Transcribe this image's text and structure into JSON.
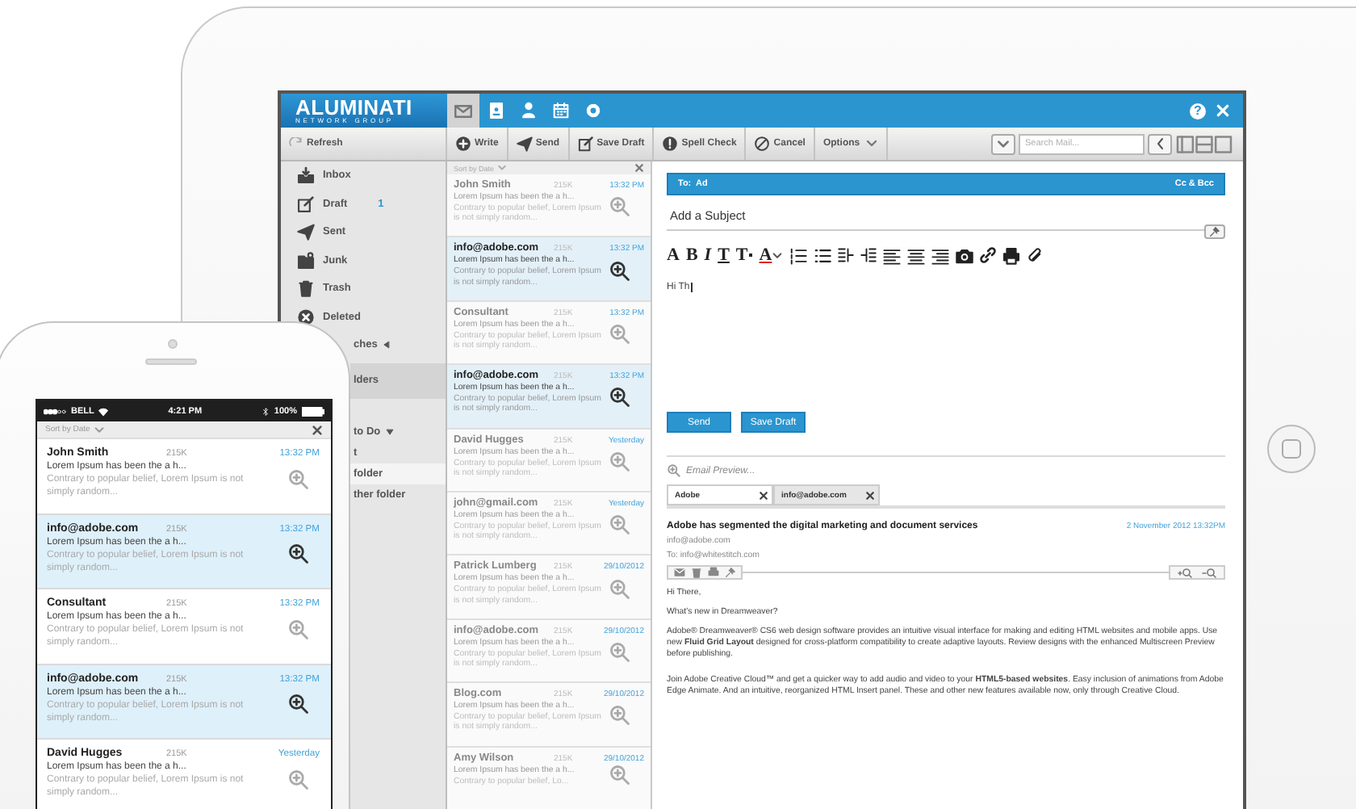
{
  "tablet": {
    "logo": {
      "title": "ALUMINATI",
      "subtitle": "NETWORK GROUP"
    },
    "app_tabs": [
      {
        "kind": "mail",
        "selected": true
      },
      {
        "kind": "contacts",
        "selected": false
      },
      {
        "kind": "person",
        "selected": false
      },
      {
        "kind": "calendar",
        "selected": false
      },
      {
        "kind": "settings",
        "selected": false
      }
    ],
    "help": "?",
    "toolbar": {
      "refresh": "Refresh",
      "actions": [
        {
          "kind": "write",
          "label": "Write"
        },
        {
          "kind": "send",
          "label": "Send"
        },
        {
          "kind": "draft",
          "label": "Save Draft"
        },
        {
          "kind": "spell",
          "label": "Spell Check"
        },
        {
          "kind": "cancel",
          "label": "Cancel"
        },
        {
          "kind": "options",
          "label": "Options"
        }
      ],
      "search": {
        "placeholder": "Search Mail..."
      }
    },
    "folders": [
      {
        "kind": "inbox",
        "label": "Inbox",
        "selected": false
      },
      {
        "kind": "draft",
        "label": "Draft",
        "count": "1",
        "selected": false
      },
      {
        "kind": "sent",
        "label": "Sent",
        "selected": false
      },
      {
        "kind": "junk",
        "label": "Junk",
        "selected": false
      },
      {
        "kind": "trash",
        "label": "Trash",
        "selected": false
      },
      {
        "kind": "deleted",
        "label": "Deleted",
        "selected": false
      },
      {
        "kind": "collapsed",
        "label": "ches",
        "selected": false
      },
      {
        "kind": "section",
        "label": "lders",
        "selected": false
      },
      {
        "kind": "expanded",
        "label": "to Do",
        "selected": false
      },
      {
        "kind": "plain",
        "label": "t",
        "selected": false
      },
      {
        "kind": "plain",
        "label": "folder",
        "selected": true
      },
      {
        "kind": "plain",
        "label": "ther folder",
        "selected": false
      }
    ],
    "list": {
      "sort_label": "Sort by Date",
      "rows": [
        {
          "sender": "John Smith",
          "size": "215K",
          "time": "13:32 PM",
          "subject": "Lorem Ipsum has been the a h...",
          "snippet": "Contrary to popular belief, Lorem Ipsum is not simply random...",
          "selected": false
        },
        {
          "sender": "info@adobe.com",
          "size": "215K",
          "time": "13:32 PM",
          "subject": "Lorem Ipsum has been the a h...",
          "snippet": "Contrary to popular belief, Lorem Ipsum is not simply random...",
          "selected": true
        },
        {
          "sender": "Consultant",
          "size": "215K",
          "time": "13:32 PM",
          "subject": "Lorem Ipsum has been the a h...",
          "snippet": "Contrary to popular belief, Lorem Ipsum is not simply random...",
          "selected": false
        },
        {
          "sender": "info@adobe.com",
          "size": "215K",
          "time": "13:32 PM",
          "subject": "Lorem Ipsum has been the a h...",
          "snippet": "Contrary to popular belief, Lorem Ipsum is not simply random...",
          "selected": true
        },
        {
          "sender": "David Hugges",
          "size": "215K",
          "time": "Yesterday",
          "subject": "Lorem Ipsum has been the a h...",
          "snippet": "Contrary to popular belief, Lorem Ipsum is not simply random...",
          "selected": false
        },
        {
          "sender": "john@gmail.com",
          "size": "215K",
          "time": "Yesterday",
          "subject": "Lorem Ipsum has been the a h...",
          "snippet": "Contrary to popular belief, Lorem Ipsum is not simply random...",
          "selected": false
        },
        {
          "sender": "Patrick Lumberg",
          "size": "215K",
          "time": "29/10/2012",
          "subject": "Lorem Ipsum has been the a h...",
          "snippet": "Contrary to popular belief, Lorem Ipsum is not simply random...",
          "selected": false
        },
        {
          "sender": "info@adobe.com",
          "size": "215K",
          "time": "29/10/2012",
          "subject": "Lorem Ipsum has been the a h...",
          "snippet": "Contrary to popular belief, Lorem Ipsum is not simply random...",
          "selected": false
        },
        {
          "sender": "Blog.com",
          "size": "215K",
          "time": "29/10/2012",
          "subject": "Lorem Ipsum has been the a h...",
          "snippet": "Contrary to popular belief, Lorem Ipsum is not simply random...",
          "selected": false
        },
        {
          "sender": "Amy Wilson",
          "size": "215K",
          "time": "29/10/2012",
          "subject": "Lorem Ipsum has been the a h...",
          "snippet": "Contrary to popular belief, Lo...",
          "selected": false
        }
      ]
    },
    "compose": {
      "to_label": "To:",
      "to": "Ad",
      "cc_bcc": "Cc & Bcc",
      "subject_placeholder": "Add a Subject",
      "format_tools": [
        {
          "kind": "size",
          "label": "A"
        },
        {
          "kind": "bold",
          "label": "B"
        },
        {
          "kind": "italic",
          "label": "I"
        },
        {
          "kind": "underline",
          "label": "T"
        },
        {
          "kind": "subscript",
          "label": "T"
        },
        {
          "kind": "color",
          "label": "A"
        }
      ],
      "body": "Hi Th",
      "buttons": [
        "Send",
        "Save Draft"
      ]
    },
    "preview": {
      "label": "Email Preview...",
      "tabs": [
        {
          "label": "Adobe",
          "selected": false
        },
        {
          "label": "info@adobe.com",
          "selected": true
        }
      ],
      "subject": "Adobe has segmented the digital marketing and document services",
      "date": "2 November 2012 13:32PM",
      "from": "info@adobe.com",
      "to": "To: info@whitestitch.com",
      "paragraphs": [
        "Hi There,",
        "What's new in Dreamweaver?",
        "Adobe® Dreamweaver® CS6 web design software provides an intuitive visual interface for making and editing HTML websites and mobile apps. Use new **Fluid Grid Layout** designed for cross-platform compatibility to create adaptive layouts. Review designs with the enhanced Multiscreen Preview before publishing.",
        "Join Adobe Creative Cloud™ and get a quicker way to add audio and video to your **HTML5-based websites**.  Easy inclusion of animations from Adobe Edge Animate. And an intuitive, reorganized HTML Insert panel. These and other new features available now, only through Creative Cloud."
      ]
    }
  },
  "phone": {
    "status": {
      "carrier": "BELL",
      "time": "4:21 PM",
      "battery": "100%"
    },
    "sort_label": "Sort by Date",
    "rows": [
      {
        "sender": "John Smith",
        "size": "215K",
        "time": "13:32 PM",
        "subject": "Lorem Ipsum has been the a h...",
        "snippet": "Contrary to popular belief, Lorem Ipsum is not simply random...",
        "selected": false
      },
      {
        "sender": "info@adobe.com",
        "size": "215K",
        "time": "13:32 PM",
        "subject": "Lorem Ipsum has been the a h...",
        "snippet": "Contrary to popular belief, Lorem Ipsum is not simply random...",
        "selected": true
      },
      {
        "sender": "Consultant",
        "size": "215K",
        "time": "13:32 PM",
        "subject": "Lorem Ipsum has been the a h...",
        "snippet": "Contrary to popular belief, Lorem Ipsum is not simply random...",
        "selected": false
      },
      {
        "sender": "info@adobe.com",
        "size": "215K",
        "time": "13:32 PM",
        "subject": "Lorem Ipsum has been the a h...",
        "snippet": "Contrary to popular belief, Lorem Ipsum is not simply random...",
        "selected": true
      },
      {
        "sender": "David Hugges",
        "size": "215K",
        "time": "Yesterday",
        "subject": "Lorem Ipsum has been the a h...",
        "snippet": "Contrary to popular belief, Lorem Ipsum is not simply random...",
        "selected": false
      }
    ]
  }
}
